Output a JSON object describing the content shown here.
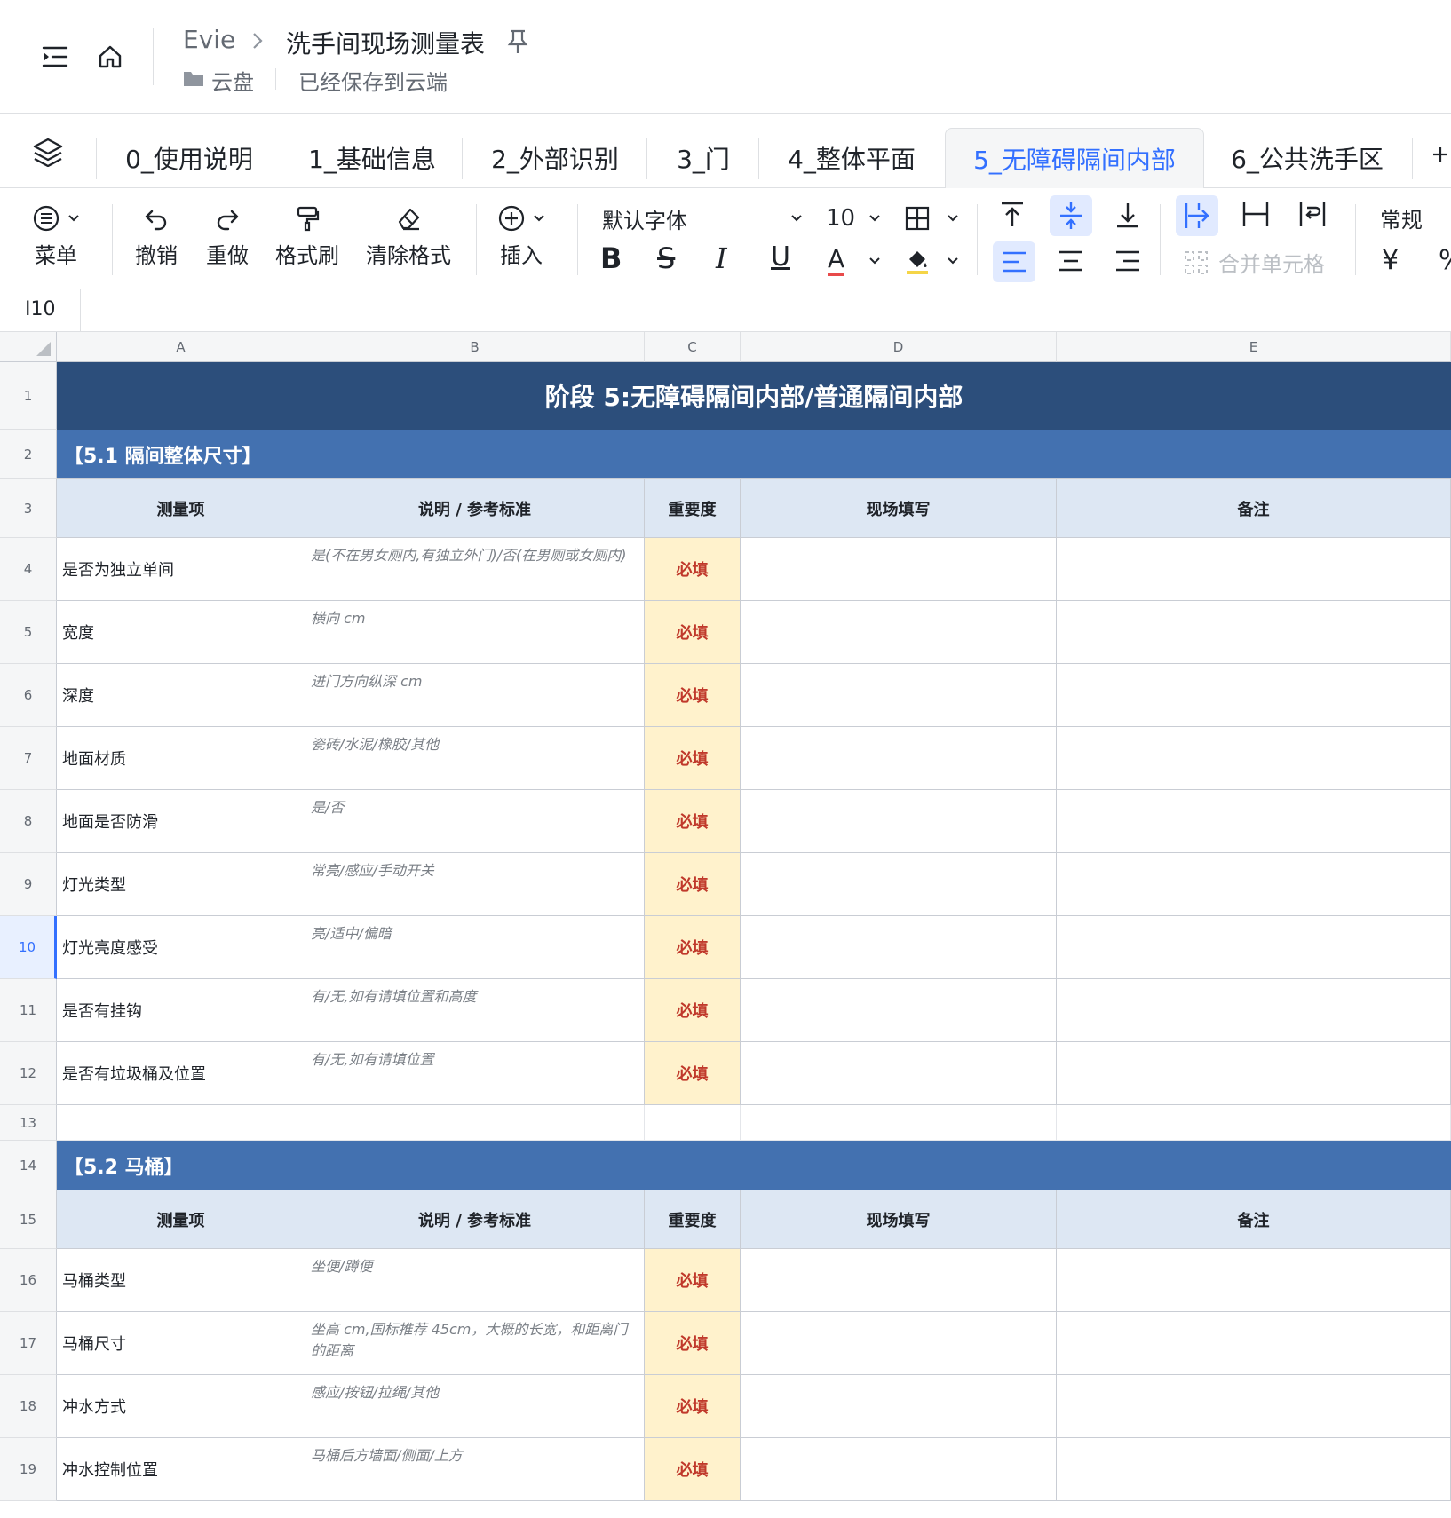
{
  "header": {
    "owner": "Evie",
    "doc_title": "洗手间现场测量表",
    "folder": "云盘",
    "save_status": "已经保存到云端"
  },
  "tabs": [
    {
      "label": "0_使用说明"
    },
    {
      "label": "1_基础信息"
    },
    {
      "label": "2_外部识别"
    },
    {
      "label": "3_门"
    },
    {
      "label": "4_整体平面"
    },
    {
      "label": "5_无障碍隔间内部",
      "active": true
    },
    {
      "label": "6_公共洗手区"
    }
  ],
  "toolbar": {
    "menu": "菜单",
    "undo": "撤销",
    "redo": "重做",
    "format_painter": "格式刷",
    "clear_format": "清除格式",
    "insert": "插入",
    "font": "默认字体",
    "font_size": "10",
    "merge": "合并单元格",
    "number_format": "常规",
    "currency": "¥",
    "percent": "%"
  },
  "formula_bar": {
    "cell_ref": "I10"
  },
  "columns": [
    "A",
    "B",
    "C",
    "D",
    "E"
  ],
  "sheet": {
    "banner": "阶段 5:无障碍隔间内部/普通隔间内部",
    "section1": "【5.1 隔间整体尺寸】",
    "section2": "【5.2 马桶】",
    "headers": [
      "测量项",
      "说明 / 参考标准",
      "重要度",
      "现场填写",
      "备注"
    ],
    "required": "必填",
    "s1_rows": [
      {
        "item": "是否为独立单间",
        "desc": "是(不在男女厕内,有独立外门)/否(在男厕或女厕内)"
      },
      {
        "item": "宽度",
        "desc": "横向 cm"
      },
      {
        "item": "深度",
        "desc": "进门方向纵深 cm"
      },
      {
        "item": "地面材质",
        "desc": "瓷砖/水泥/橡胶/其他"
      },
      {
        "item": "地面是否防滑",
        "desc": "是/否"
      },
      {
        "item": "灯光类型",
        "desc": "常亮/感应/手动开关"
      },
      {
        "item": "灯光亮度感受",
        "desc": "亮/适中/偏暗"
      },
      {
        "item": "是否有挂钩",
        "desc": "有/无,如有请填位置和高度"
      },
      {
        "item": "是否有垃圾桶及位置",
        "desc": "有/无,如有请填位置"
      }
    ],
    "s2_rows": [
      {
        "item": "马桶类型",
        "desc": "坐便/蹲便"
      },
      {
        "item": "马桶尺寸",
        "desc": "坐高 cm,国标推荐 45cm，大概的长宽，和距离门的距离"
      },
      {
        "item": "冲水方式",
        "desc": "感应/按钮/拉绳/其他"
      },
      {
        "item": "冲水控制位置",
        "desc": "马桶后方墙面/侧面/上方"
      }
    ]
  },
  "row_numbers": [
    "1",
    "2",
    "3",
    "4",
    "5",
    "6",
    "7",
    "8",
    "9",
    "10",
    "11",
    "12",
    "13",
    "14",
    "15",
    "16",
    "17",
    "18",
    "19"
  ],
  "selected_row": "10",
  "colors": {
    "banner": "#2c4e7b",
    "section": "#4371b0",
    "header_fill": "#dde7f3",
    "required_fill": "#fff2cc",
    "required_text": "#c0392b",
    "accent": "#3370ff"
  }
}
